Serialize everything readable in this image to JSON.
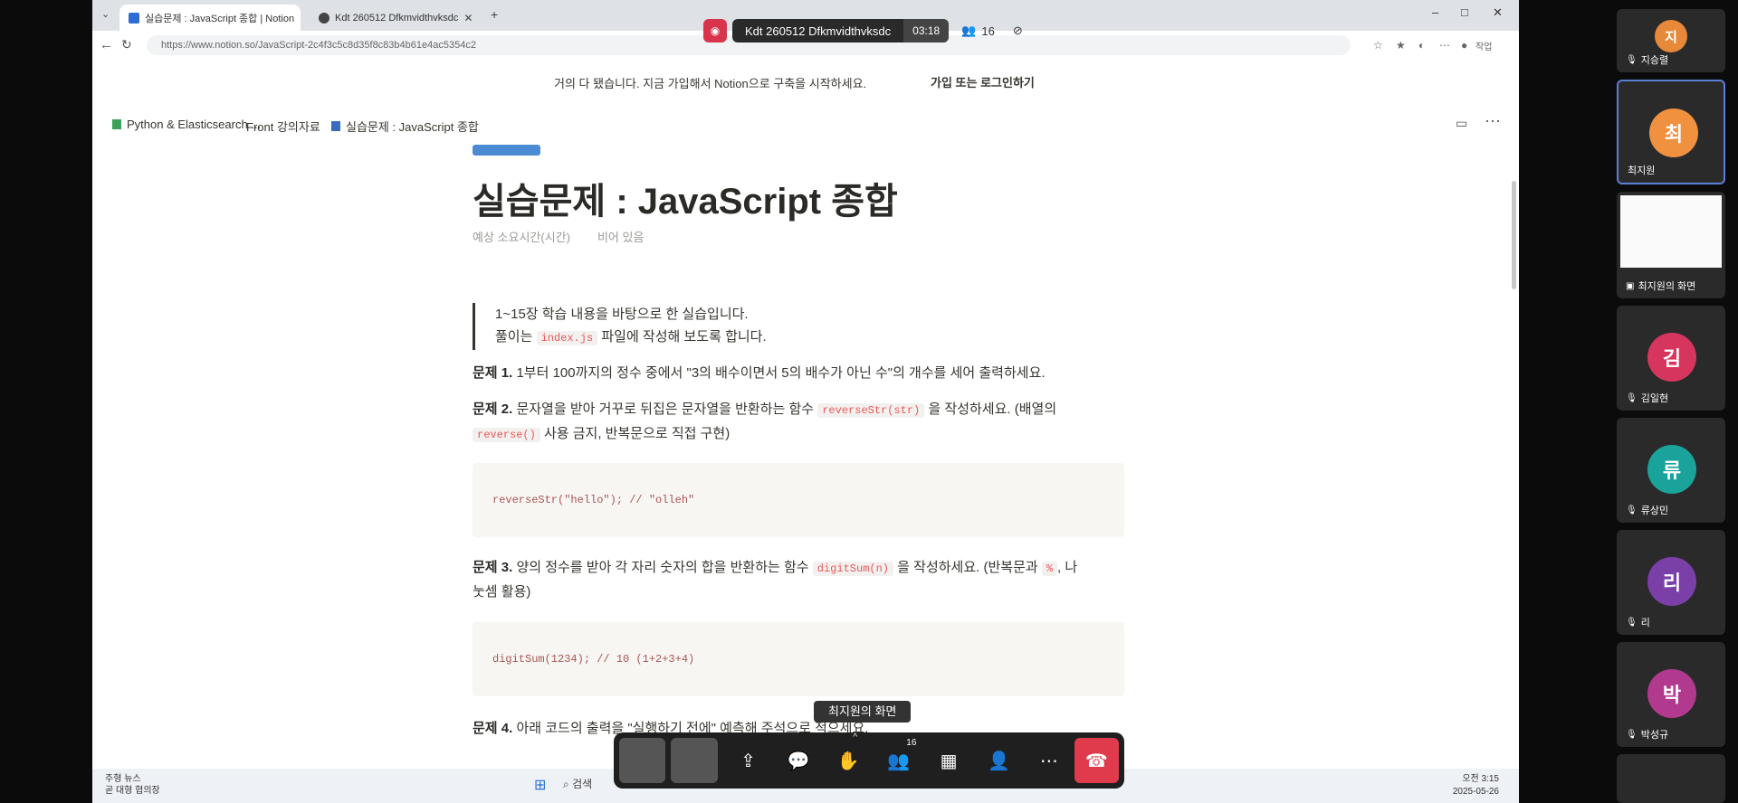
{
  "browser": {
    "tabs": [
      {
        "label": "실습문제 : JavaScript 종합 | Notion",
        "active": true
      },
      {
        "label": "Kdt 260512 Dfkmvidthvksdc",
        "active": false
      }
    ],
    "new_tab_label": "+",
    "url": "https://www.notion.so/JavaScript-2c4f3c5c8d35f8c83b4b61e4ac5354c2",
    "profile_label": "작업"
  },
  "meeting": {
    "recording_name": "Kdt 260512 Dfkmvidthvksdc",
    "timer": "03:18",
    "participant_count": "16",
    "tooltip": "최지원의 화면",
    "participants_badge": "16"
  },
  "notion": {
    "banner_message": "거의 다 됐습니다. 지금 가입해서 Notion으로 구축을 시작하세요.",
    "banner_cta": "가입 또는 로그인하기",
    "breadcrumbs": [
      "Python & Elasticsearch ...",
      "Front 강의자료",
      "실습문제 : JavaScript 종합"
    ],
    "page_title": "실습문제 : JavaScript 종합",
    "property_1": "예상 소요시간(시간)",
    "property_2": "비어 있음",
    "quote_line1": "1~15장 학습 내용을 바탕으로 한 실습입니다.",
    "quote_line2_pre": "풀이는",
    "quote_line2_code": "index.js",
    "quote_line2_post": "파일에 작성해 보도록 합니다.",
    "q1_label": "문제 1.",
    "q1_text": "1부터 100까지의 정수 중에서 \"3의 배수이면서 5의 배수가 아닌 수\"의 개수를 세어 출력하세요.",
    "q2_label": "문제 2.",
    "q2_text_a": "문자열을 받아 거꾸로 뒤집은 문자열을 반환하는 함수",
    "q2_code_a": "reverseStr(str)",
    "q2_text_b": "을 작성하세요. (배열의",
    "q2_code_b": "reverse()",
    "q2_text_c": "사용 금지, 반복문으로 직접 구현)",
    "q2_code_block": "reverseStr(\"hello\"); // \"olleh\"",
    "q3_label": "문제 3.",
    "q3_text_a": "양의 정수를 받아 각 자리 숫자의 합을 반환하는 함수",
    "q3_code_a": "digitSum(n)",
    "q3_text_b": "을 작성하세요. (반복문과",
    "q3_code_b": "%",
    "q3_text_c": ", 나",
    "q3_text_d": "눗셈 활용)",
    "q3_code_block": "digitSum(1234); // 10  (1+2+3+4)",
    "q4_label": "문제 4.",
    "q4_text": "아래 코드의 출력을 \"실행하기 전에\" 예측해 주석으로 적으세요."
  },
  "taskbar": {
    "news_title": "주형 뉴스",
    "news_sub": "곧 대형 협의장",
    "search_label": "검색",
    "time": "오전 3:15",
    "date": "2025-05-26"
  },
  "participants": [
    {
      "name": "지승렬",
      "initial": "지",
      "color": "#e8893a"
    },
    {
      "name": "최지원",
      "initial": "최",
      "color": "#f0913f"
    },
    {
      "name": "최지원의 화면",
      "initial": "",
      "color": ""
    },
    {
      "name": "김일현",
      "initial": "김",
      "color": "#d6365e"
    },
    {
      "name": "류상민",
      "initial": "류",
      "color": "#1aa39a"
    },
    {
      "name": "리",
      "initial": "리",
      "color": "#7b3fa8"
    },
    {
      "name": "박성규",
      "initial": "박",
      "color": "#b23a8e"
    }
  ]
}
